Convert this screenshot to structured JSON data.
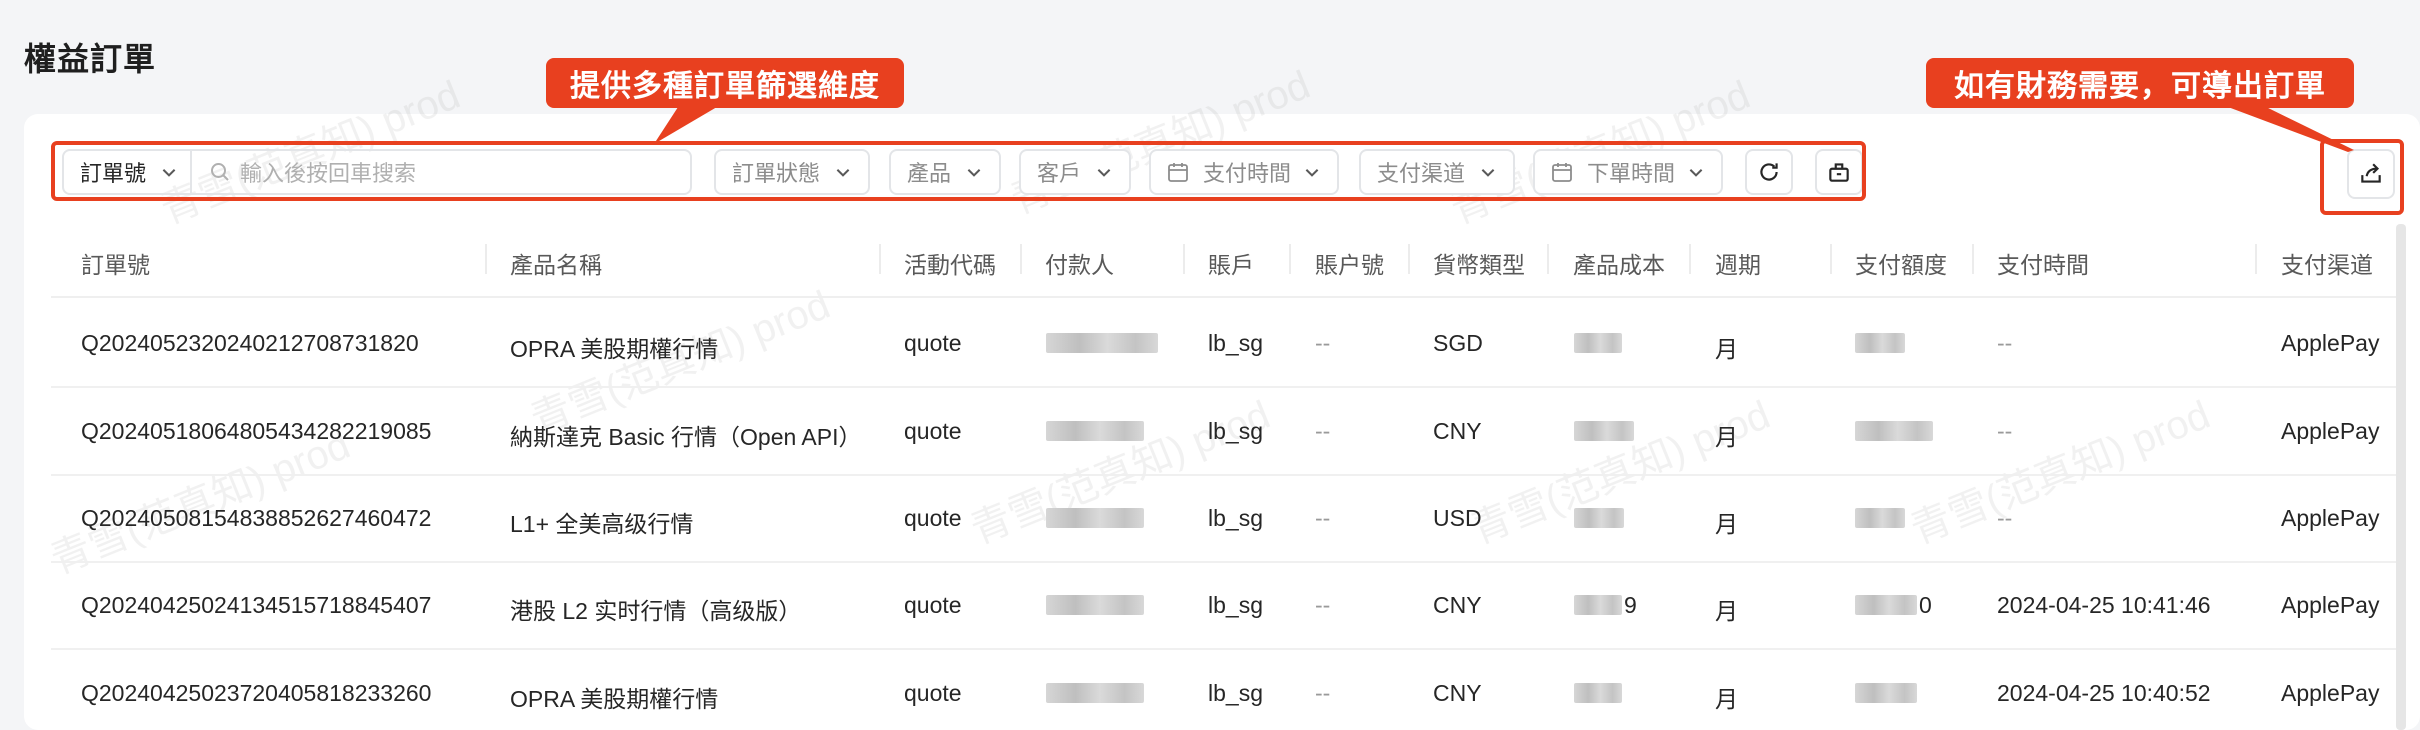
{
  "page": {
    "title": "權益訂單"
  },
  "filters": {
    "order_field": "訂單號",
    "search_placeholder": "輸入後按回車搜索",
    "order_status": "訂單狀態",
    "product": "產品",
    "customer": "客戶",
    "pay_time": "支付時間",
    "pay_channel": "支付渠道",
    "order_time": "下單時間"
  },
  "annotations": {
    "filters_note": "提供多種訂單篩選維度",
    "export_note": "如有財務需要，可導出訂單"
  },
  "table": {
    "columns": [
      "訂單號",
      "產品名稱",
      "活動代碼",
      "付款人",
      "賬戶",
      "賬户號",
      "貨幣類型",
      "產品成本",
      "週期",
      "支付額度",
      "支付時間",
      "支付渠道"
    ],
    "rows": [
      {
        "order_no": "Q202405232024021270873182​0",
        "product": "OPRA 美股期權行情",
        "campaign": "quote",
        "account": "lb_sg",
        "account_no": "--",
        "currency": "SGD",
        "cost_suffix": "",
        "cycle": "月",
        "amount_suffix": "",
        "pay_time": "--",
        "channel": "ApplePay"
      },
      {
        "order_no": "Q202405180648054342822190​85",
        "product": "納斯達克 Basic 行情（Open API）",
        "campaign": "quote",
        "account": "lb_sg",
        "account_no": "--",
        "currency": "CNY",
        "cost_suffix": "",
        "cycle": "月",
        "amount_suffix": "",
        "pay_time": "--",
        "channel": "ApplePay"
      },
      {
        "order_no": "Q202405081548388526274604​72",
        "product": "L1+ 全美高级行情",
        "campaign": "quote",
        "account": "lb_sg",
        "account_no": "--",
        "currency": "USD",
        "cost_suffix": "",
        "cycle": "月",
        "amount_suffix": "",
        "pay_time": "--",
        "channel": "ApplePay"
      },
      {
        "order_no": "Q202404250241345157188454​07",
        "product": "港股 L2 实时行情（高级版）",
        "campaign": "quote",
        "account": "lb_sg",
        "account_no": "--",
        "currency": "CNY",
        "cost_suffix": "9",
        "cycle": "月",
        "amount_suffix": "0",
        "pay_time": "2024-04-25 10:41:46",
        "channel": "ApplePay"
      },
      {
        "order_no": "Q202404250237204058182332​60",
        "product": "OPRA 美股期權行情",
        "campaign": "quote",
        "account": "lb_sg",
        "account_no": "--",
        "currency": "CNY",
        "cost_suffix": "",
        "cycle": "月",
        "amount_suffix": "",
        "pay_time": "2024-04-25 10:40:52",
        "channel": "ApplePay"
      }
    ]
  },
  "watermark": "青雪(范真知) prod",
  "colors": {
    "accent": "#e8401f",
    "background": "#f4f5f7",
    "card": "#ffffff"
  }
}
